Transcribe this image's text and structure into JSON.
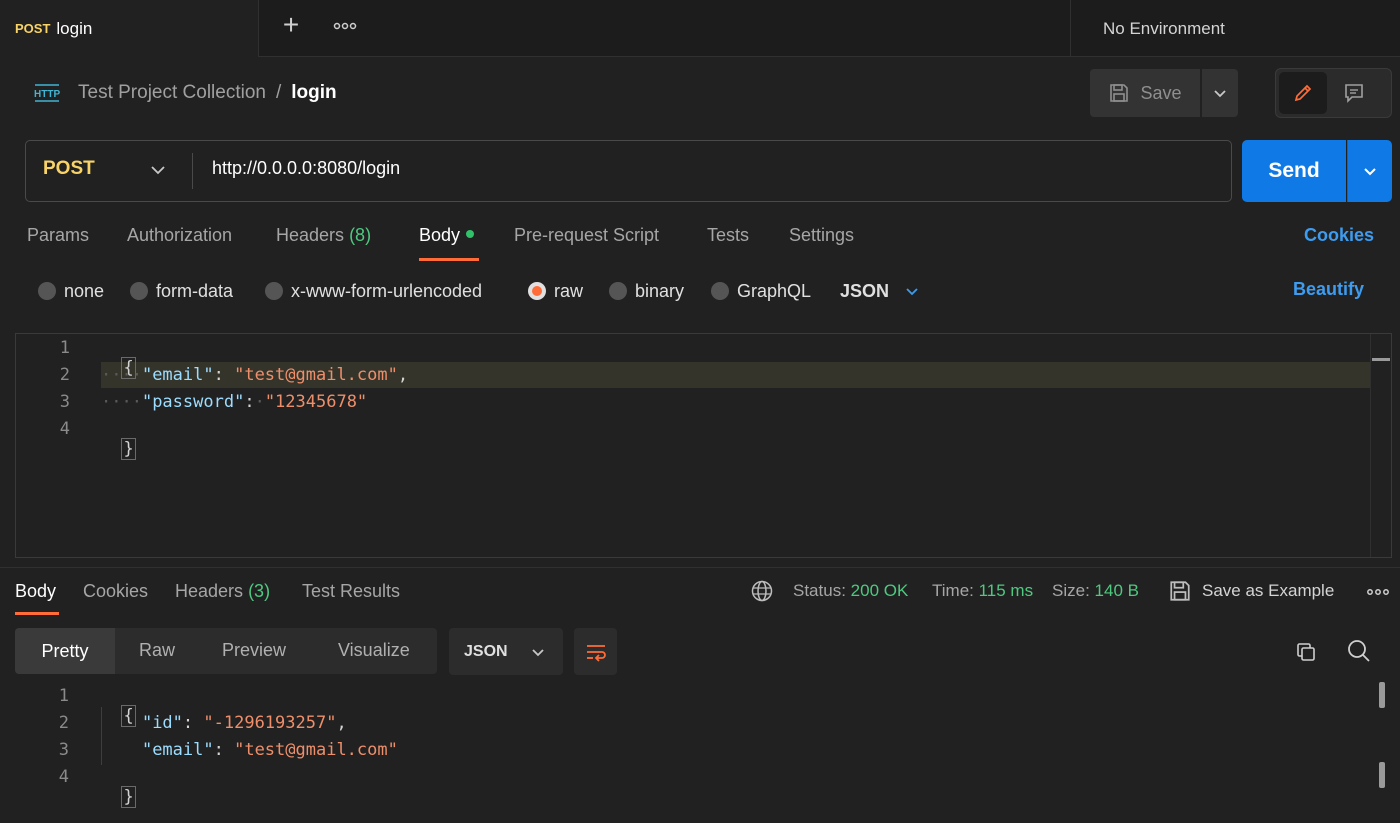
{
  "tabs": {
    "active_method": "POST",
    "active_name": "login",
    "new_tab_label": "+",
    "more_label": "∘∘∘",
    "environment": "No Environment"
  },
  "breadcrumb": {
    "icon": "http-icon",
    "collection": "Test Project Collection",
    "separator": "/",
    "request": "login"
  },
  "toolbar": {
    "save_label": "Save"
  },
  "request": {
    "method": "POST",
    "url": "http://0.0.0.0:8080/login",
    "send_label": "Send",
    "tabs": {
      "params": "Params",
      "authorization": "Authorization",
      "headers": "Headers",
      "headers_count": "(8)",
      "body": "Body",
      "prerequest": "Pre-request Script",
      "tests": "Tests",
      "settings": "Settings"
    },
    "cookies_label": "Cookies",
    "body_types": {
      "none": "none",
      "form_data": "form-data",
      "urlencoded": "x-www-form-urlencoded",
      "raw": "raw",
      "binary": "binary",
      "graphql": "GraphQL",
      "language": "JSON"
    },
    "selected_body_type": "raw",
    "beautify_label": "Beautify",
    "editor": {
      "line_numbers": [
        "1",
        "2",
        "3",
        "4"
      ],
      "open_brace": "{",
      "close_brace": "}",
      "key_email": "\"email\"",
      "val_email": "\"test@gmail.com\"",
      "key_password": "\"password\"",
      "val_password": "\"12345678\""
    }
  },
  "response": {
    "tabs": {
      "body": "Body",
      "cookies": "Cookies",
      "headers": "Headers",
      "headers_count": "(3)",
      "test_results": "Test Results"
    },
    "status_label": "Status:",
    "status_value": "200 OK",
    "time_label": "Time:",
    "time_value": "115 ms",
    "size_label": "Size:",
    "size_value": "140 B",
    "save_example_label": "Save as Example",
    "formats": {
      "pretty": "Pretty",
      "raw": "Raw",
      "preview": "Preview",
      "visualize": "Visualize"
    },
    "language": "JSON",
    "body": {
      "line_numbers": [
        "1",
        "2",
        "3",
        "4"
      ],
      "open_brace": "{",
      "close_brace": "}",
      "key_id": "\"id\"",
      "val_id": "\"-1296193257\"",
      "key_email": "\"email\"",
      "val_email": "\"test@gmail.com\""
    }
  },
  "colors": {
    "accent_orange": "#ff6c37",
    "send_blue": "#0f7ae5",
    "method_yellow": "#f8d368",
    "status_green": "#4fc880",
    "link_blue": "#3d9cf0"
  }
}
